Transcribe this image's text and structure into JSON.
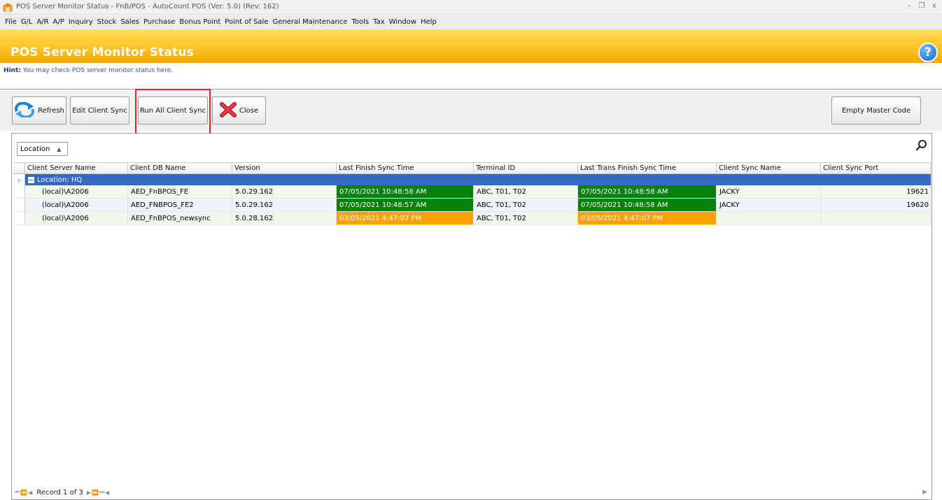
{
  "window": {
    "title": "POS Server Monitor Status - FnB/POS - AutoCount POS (Ver: 5.0) (Rev: 162)",
    "controls": {
      "minimize": "–",
      "restore": "❐",
      "close": "x"
    }
  },
  "menu": [
    "File",
    "G/L",
    "A/R",
    "A/P",
    "Inquiry",
    "Stock",
    "Sales",
    "Purchase",
    "Bonus Point",
    "Point of Sale",
    "General Maintenance",
    "Tools",
    "Tax",
    "Window",
    "Help"
  ],
  "header": {
    "title": "POS Server Monitor Status",
    "help": "?"
  },
  "hint": {
    "label": "Hint:",
    "text": "You may check POS server monitor status here."
  },
  "toolbar": {
    "refresh": "Refresh",
    "edit_client_sync": "Edit Client Sync",
    "run_all_client_sync": "Run All Client Sync",
    "close": "Close",
    "empty_master_code": "Empty Master Code"
  },
  "grid": {
    "group_by": "Location",
    "columns": [
      "Client Server Name",
      "Client DB Name",
      "Version",
      "Last Finish Sync Time",
      "Terminal ID",
      "Last Trans Finish Sync Time",
      "Client Sync Name",
      "Client Sync Port"
    ],
    "group_label": "Location: HQ",
    "rows": [
      {
        "server": "(local)\\A2006",
        "db": "AED_FnBPOS_FE",
        "version": "5.0.29.162",
        "last_sync": "07/05/2021 10:48:58 AM",
        "terminal": "ABC, T01, T02",
        "last_trans": "07/05/2021 10:48:58 AM",
        "sync_name": "JACKY",
        "port": "19621"
      },
      {
        "server": "(local)\\A2006",
        "db": "AED_FNBPOS_FE2",
        "version": "5.0.29.162",
        "last_sync": "07/05/2021 10:48:57 AM",
        "terminal": "ABC, T01, T02",
        "last_trans": "07/05/2021 10:48:58 AM",
        "sync_name": "JACKY",
        "port": "19620"
      },
      {
        "server": "(local)\\A2006",
        "db": "AED_FnBPOS_newsync",
        "version": "5.0.28.162",
        "last_sync": "03/05/2021 4:47:07 PM",
        "terminal": "ABC, T01, T02",
        "last_trans": "03/05/2021 4:47:07 PM",
        "sync_name": "",
        "port": ""
      }
    ]
  },
  "navigator": {
    "record_text": "Record 1 of 3"
  },
  "colors": {
    "accent": "#f2a900",
    "group": "#3568c4",
    "ok": "#0a7f0a",
    "warn": "#fca200",
    "highlight": "#e0262b"
  }
}
